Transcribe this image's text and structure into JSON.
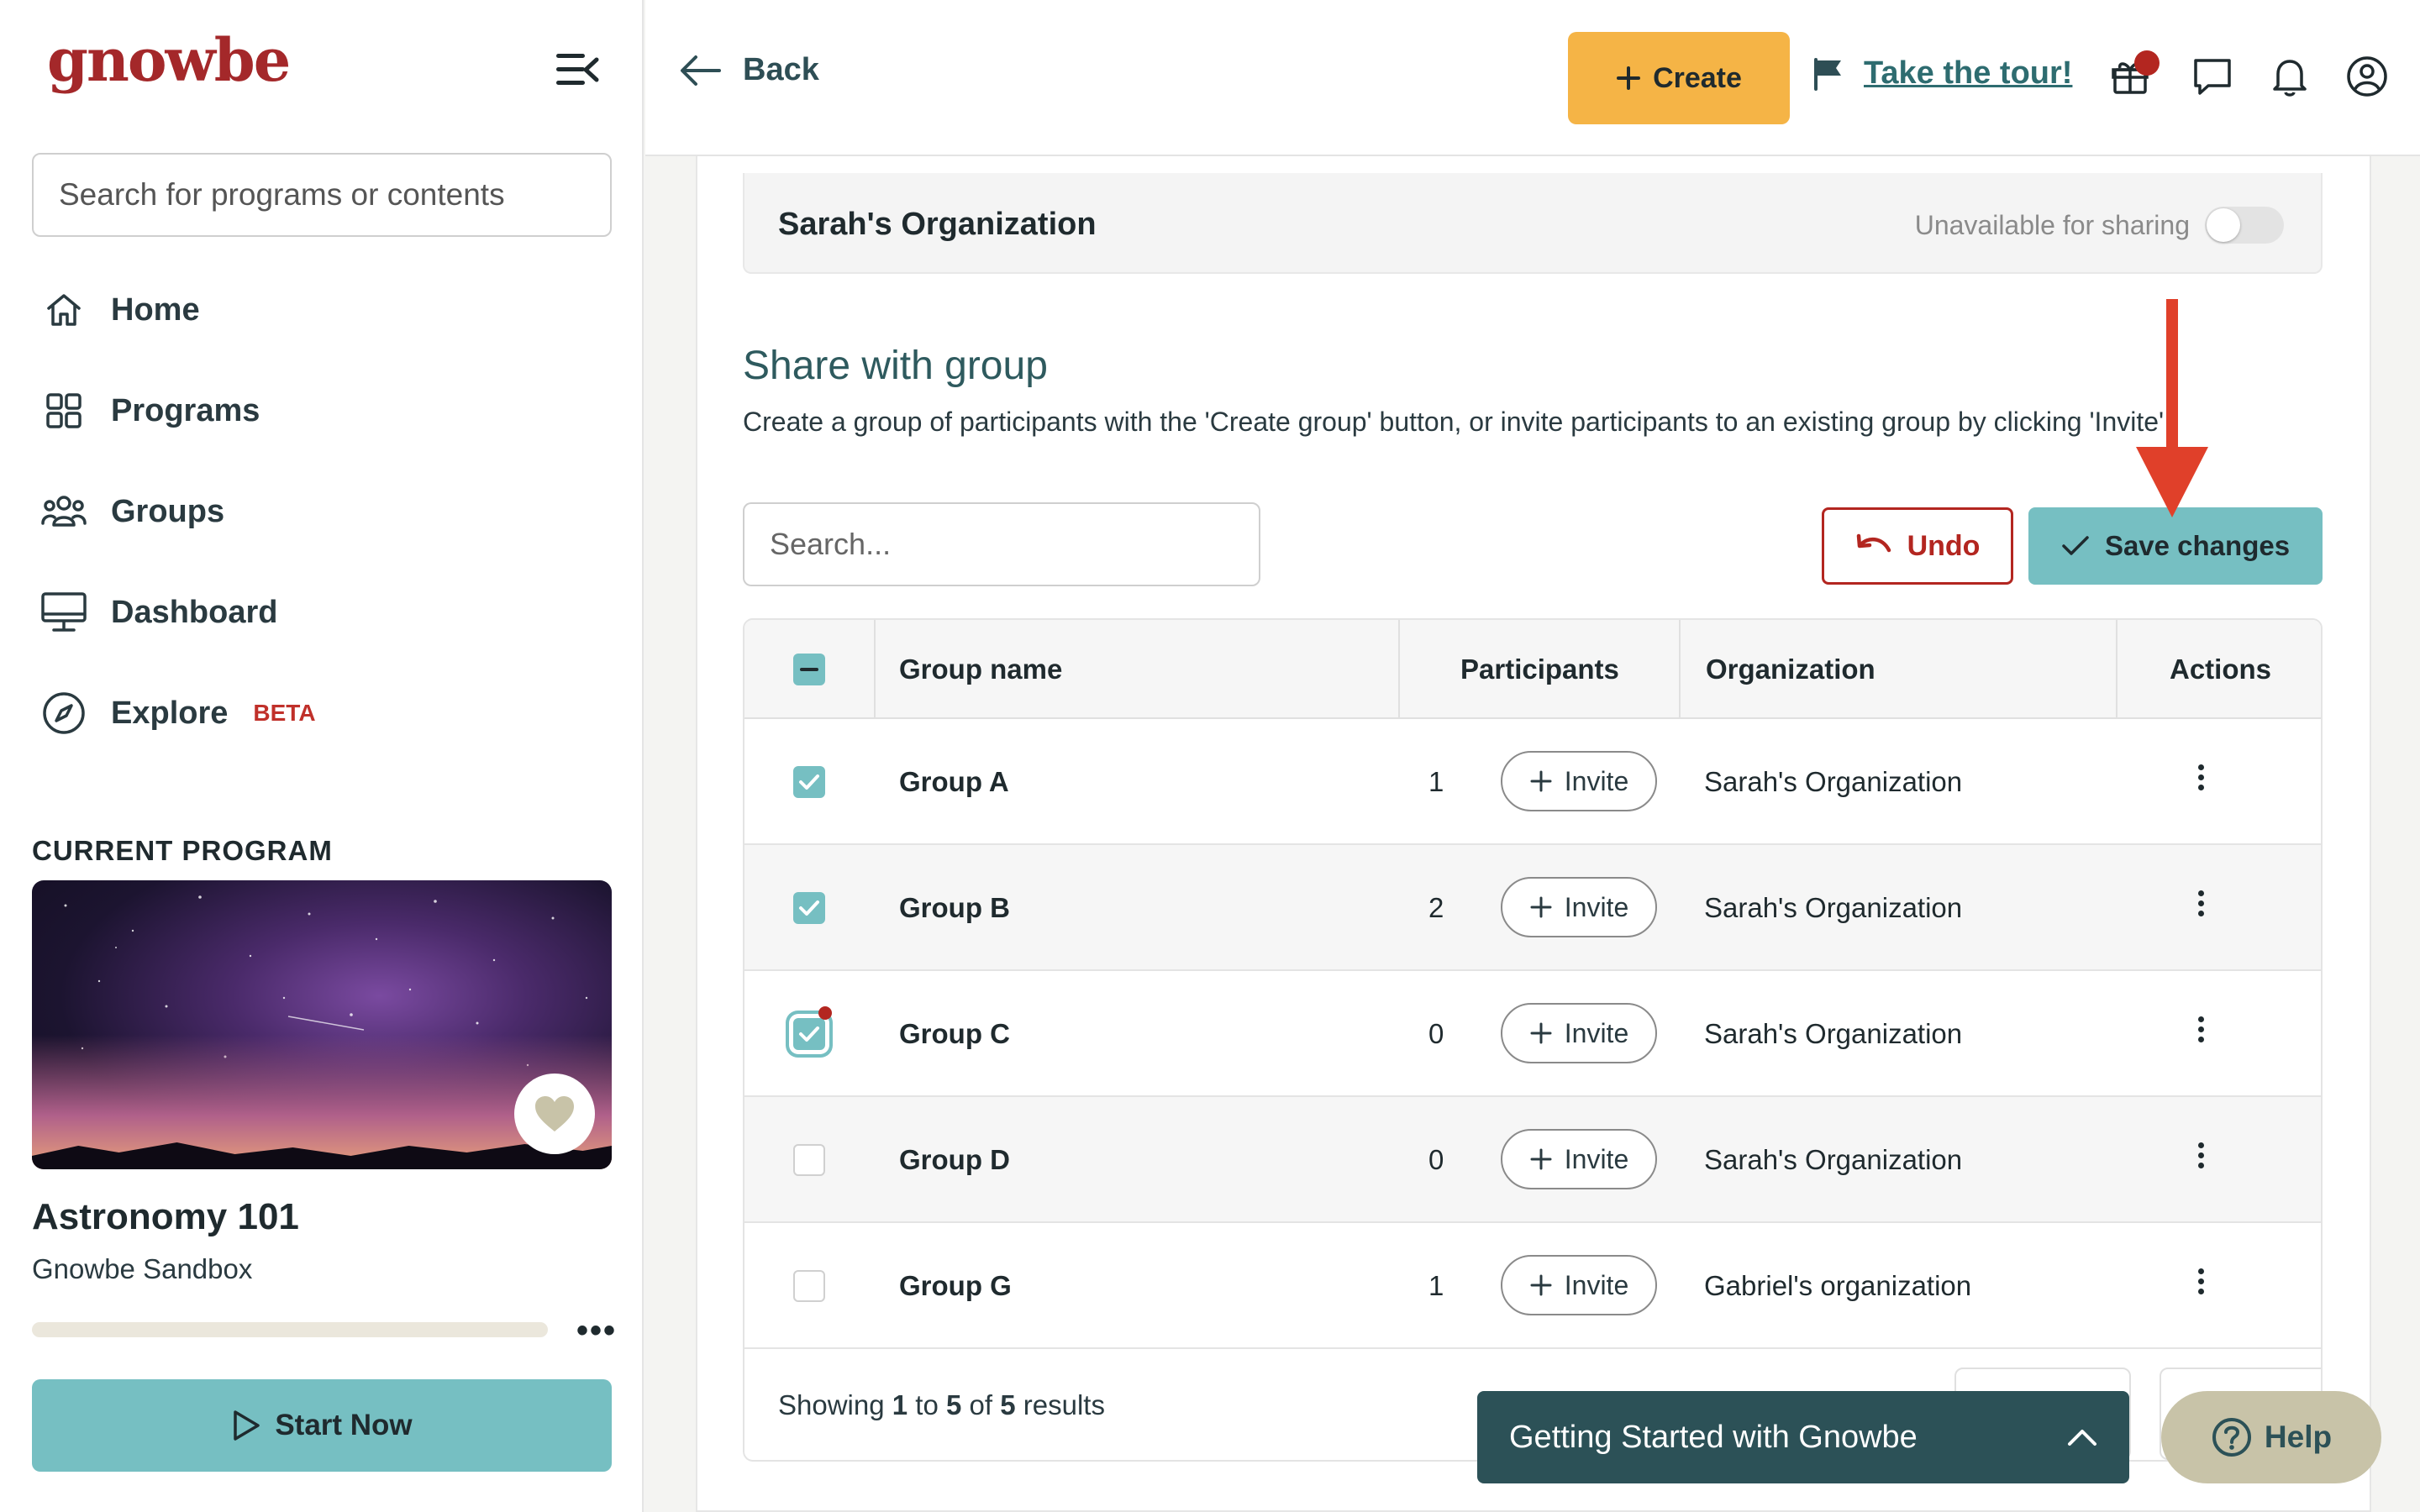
{
  "sidebar": {
    "logo": "gnowbe",
    "search_placeholder": "Search for programs or contents",
    "nav": [
      {
        "label": "Home",
        "icon": "home-icon"
      },
      {
        "label": "Programs",
        "icon": "grid-icon"
      },
      {
        "label": "Groups",
        "icon": "users-icon"
      },
      {
        "label": "Dashboard",
        "icon": "monitor-icon"
      },
      {
        "label": "Explore",
        "icon": "compass-icon",
        "badge": "BETA"
      }
    ],
    "current_program_label": "CURRENT PROGRAM",
    "program": {
      "title": "Astronomy 101",
      "subtitle": "Gnowbe Sandbox",
      "progress": 0,
      "start_label": "Start Now"
    }
  },
  "topbar": {
    "back_label": "Back",
    "create_label": "Create",
    "tour_label": "Take the tour!",
    "icons": [
      "gift-icon",
      "chat-icon",
      "bell-icon",
      "profile-icon"
    ]
  },
  "org_row": {
    "name": "Sarah's Organization",
    "status": "Unavailable for sharing",
    "sharing_enabled": false
  },
  "share": {
    "title": "Share with group",
    "description": "Create a group of participants with the 'Create group' button, or invite participants to an existing group by clicking 'Invite'.",
    "search_placeholder": "Search...",
    "undo_label": "Undo",
    "save_label": "Save changes"
  },
  "table": {
    "headers": {
      "name": "Group name",
      "participants": "Participants",
      "organization": "Organization",
      "actions": "Actions"
    },
    "invite_label": "Invite",
    "rows": [
      {
        "name": "Group A",
        "participants": "1",
        "organization": "Sarah's Organization",
        "checked": true
      },
      {
        "name": "Group B",
        "participants": "2",
        "organization": "Sarah's Organization",
        "checked": true
      },
      {
        "name": "Group C",
        "participants": "0",
        "organization": "Sarah's Organization",
        "checked": true
      },
      {
        "name": "Group D",
        "participants": "0",
        "organization": "Sarah's Organization",
        "checked": false
      },
      {
        "name": "Group G",
        "participants": "1",
        "organization": "Gabriel's organization",
        "checked": false
      }
    ],
    "footer": {
      "prefix": "Showing",
      "from": "1",
      "to_word": "to",
      "to": "5",
      "of_word": "of",
      "total": "5",
      "suffix": "results"
    }
  },
  "floating": {
    "getting_started": "Getting Started with Gnowbe",
    "help_label": "Help"
  },
  "colors": {
    "brand_red": "#a4282a",
    "accent_teal": "#76bfc2",
    "create_yellow": "#f5b446",
    "dark_teal": "#2c5157",
    "annotation_arrow": "#e0402a"
  }
}
